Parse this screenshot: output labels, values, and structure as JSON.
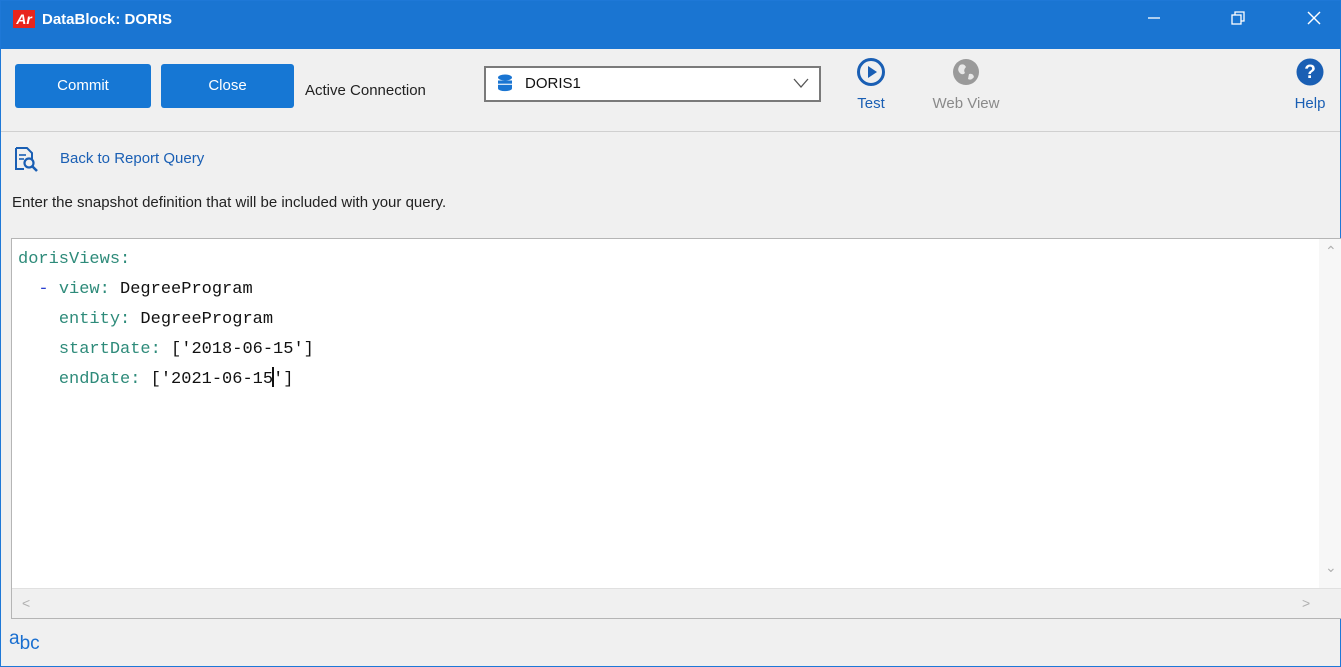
{
  "window": {
    "app_logo": "Ar",
    "title": "DataBlock: DORIS",
    "controls": {
      "minimize": "—",
      "restore": "❐",
      "close": "✕"
    }
  },
  "toolbar": {
    "commit_label": "Commit",
    "close_label": "Close",
    "connection_label": "Active Connection",
    "connection_value": "DORIS1",
    "test_label": "Test",
    "webview_label": "Web View",
    "help_label": "Help"
  },
  "back_link": "Back to Report Query",
  "instructions": "Enter the snapshot definition that will be included with your query.",
  "editor": {
    "lines": [
      {
        "key": "dorisViews:",
        "value": ""
      },
      {
        "prefix": "- ",
        "key": "view:",
        "value": " DegreeProgram"
      },
      {
        "key": "entity:",
        "value": " DegreeProgram"
      },
      {
        "key": "startDate:",
        "value": " ['2018-06-15']"
      },
      {
        "key": "endDate:",
        "value_before_cursor": " ['2021-06-15",
        "value_after_cursor": "']"
      }
    ]
  },
  "spellcheck_icon": "icon-spellcheck",
  "colors": {
    "titlebar": "#1a75d2",
    "button": "#1677d4",
    "link": "#1a5fb4",
    "yaml_key": "#2e8b7a",
    "yaml_dash": "#2a3fd0"
  }
}
